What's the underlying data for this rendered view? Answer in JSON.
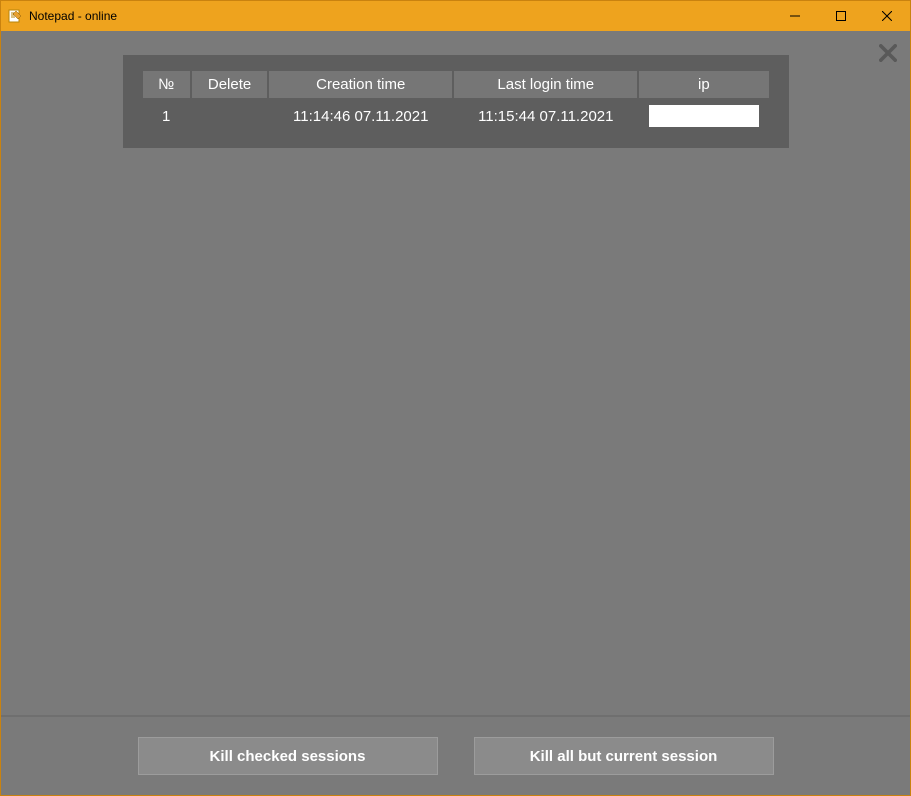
{
  "window": {
    "title": "Notepad - online"
  },
  "table": {
    "headers": {
      "number": "№",
      "delete": "Delete",
      "creation_time": "Creation time",
      "last_login_time": "Last login time",
      "ip": "ip"
    },
    "rows": [
      {
        "number": "1",
        "delete": "",
        "creation_time": "11:14:46 07.11.2021",
        "last_login_time": "11:15:44 07.11.2021",
        "ip": ""
      }
    ]
  },
  "footer": {
    "kill_checked": "Kill checked sessions",
    "kill_all_but_current": "Kill all but current session"
  }
}
